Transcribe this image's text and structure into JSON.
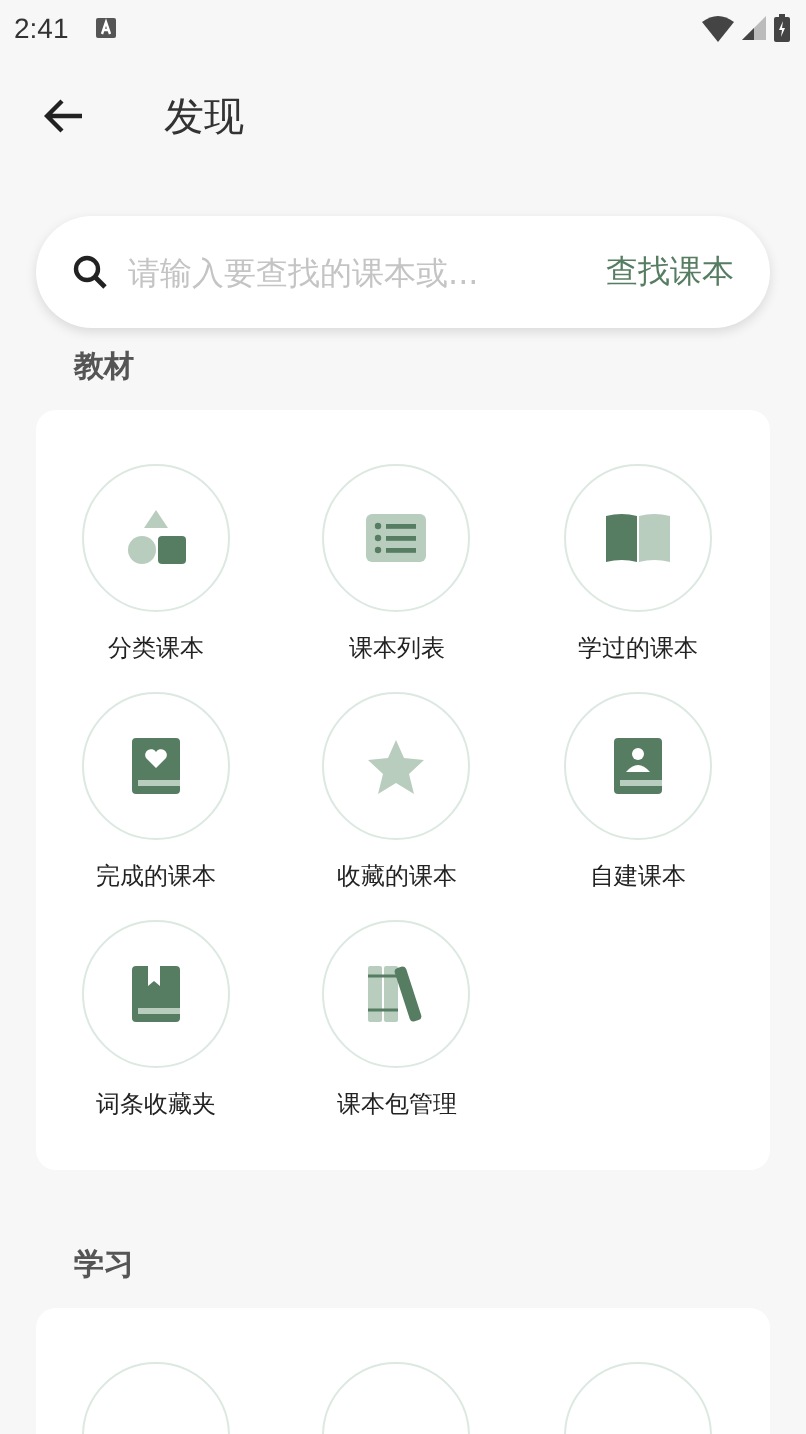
{
  "status_bar": {
    "time": "2:41"
  },
  "header": {
    "title": "发现"
  },
  "search": {
    "placeholder": "请输入要查找的课本或...",
    "button": "查找课本"
  },
  "sections": [
    {
      "title": "教材",
      "items": [
        {
          "label": "分类课本",
          "kind": "shapes"
        },
        {
          "label": "课本列表",
          "kind": "list"
        },
        {
          "label": "学过的课本",
          "kind": "open-book"
        },
        {
          "label": "完成的课本",
          "kind": "heart-book"
        },
        {
          "label": "收藏的课本",
          "kind": "star"
        },
        {
          "label": "自建课本",
          "kind": "person-book"
        },
        {
          "label": "词条收藏夹",
          "kind": "bookmark-book"
        },
        {
          "label": "课本包管理",
          "kind": "books"
        }
      ]
    },
    {
      "title": "学习"
    }
  ]
}
